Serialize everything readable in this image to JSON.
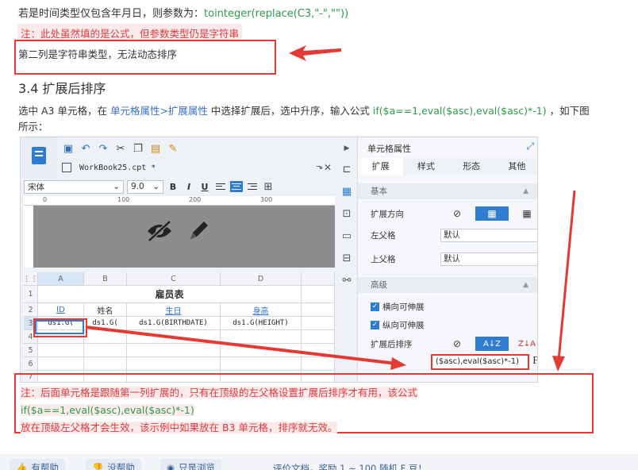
{
  "article": {
    "line1_prefix": "若是时间类型仅包含年月日，则参数为：",
    "line1_code": "tointeger(replace(C3,\"-\",\"\"))",
    "note1": "注：此处虽然填的是公式，但参数类型仍是字符串",
    "line3": "第二列是字符串类型，无法动态排序",
    "heading": "3.4 扩展后排序",
    "para_1": "选中 A3 单元格，在 ",
    "para_link": "单元格属性>扩展属性",
    "para_2": " 中选择扩展后，选中升序，输入公式 ",
    "para_code": "if($a==1,eval($asc),eval($asc)*-1)",
    "para_3": " ，如下图所示：",
    "note2_a": "注：后面单元格是跟随第一列扩展的，只有在顶级的左父格设置扩展后排序才有用，该公式",
    "note2_code": "if($a==1,eval($asc),eval($asc)*-1)",
    "note2_b": "放在顶级左父格才会生效，该示例中如果放在 B3 单元格，排序就无效。"
  },
  "designer": {
    "tab_name": "WorkBook25.cpt *",
    "font_name": "宋体",
    "font_size": "9.0",
    "bold": "B",
    "italic": "I",
    "underline": "U",
    "ruler_ticks": [
      "0",
      "100",
      "200",
      "300"
    ],
    "columns": [
      "A",
      "B",
      "C",
      "D"
    ],
    "rows": [
      "1",
      "2",
      "3",
      "4",
      "5",
      "6",
      "7"
    ],
    "title_cell": "雇员表",
    "headers": [
      "ID",
      "姓名",
      "生日",
      "身高"
    ],
    "data_cells": [
      "ds1.G(",
      "ds1.G(",
      "ds1.G(BIRTHDATE)",
      "ds1.G(HEIGHT)"
    ]
  },
  "panel": {
    "title": "单元格属性",
    "tabs": [
      "扩展",
      "样式",
      "形态",
      "其他"
    ],
    "section_basic": "基本",
    "expand_direction_label": "扩展方向",
    "left_parent_label": "左父格",
    "left_parent_value": "默认",
    "top_parent_label": "上父格",
    "top_parent_value": "默认",
    "section_advanced": "高级",
    "horizontal_expand": "横向可伸展",
    "vertical_expand": "纵向可伸展",
    "sort_after_expand_label": "扩展后排序",
    "formula_value": "($asc),eval($asc)*-1)",
    "fx": "Fx"
  },
  "bottom": {
    "helpful": "有帮助",
    "not_helpful": "没帮助",
    "browsed_only": "只是浏览",
    "rating_text": "评价文档，奖励 1 ~ 100 随机 F 豆！"
  },
  "colors": {
    "annotation_red": "#e53935",
    "code_green": "#2e9a47",
    "link_blue": "#3b6fc7",
    "accent_blue": "#2f7dd0"
  }
}
